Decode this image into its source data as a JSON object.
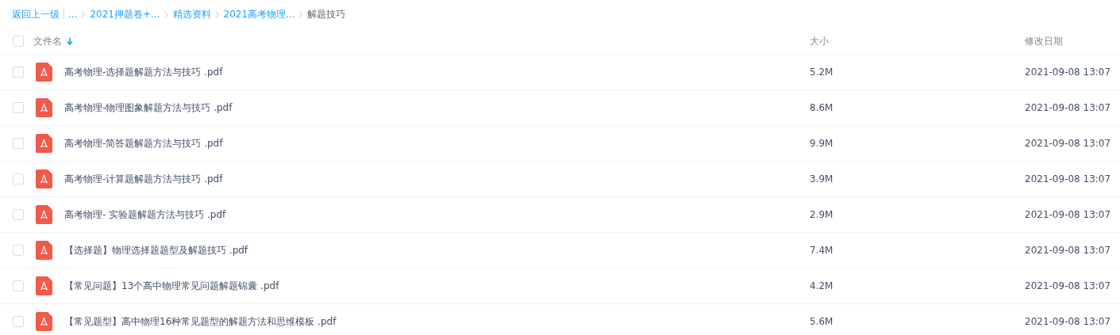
{
  "breadcrumb": {
    "back": "返回上一级",
    "items": [
      {
        "label": "..."
      },
      {
        "label": "2021押题卷+..."
      },
      {
        "label": "精选资料"
      },
      {
        "label": "2021高考物理..."
      },
      {
        "label": "解题技巧"
      }
    ]
  },
  "table": {
    "select_all": {
      "checked": false
    },
    "columns": [
      {
        "label": "文件名",
        "sorted": true
      },
      {
        "label": "大小",
        "sorted": false
      },
      {
        "label": "修改日期",
        "sorted": false
      }
    ],
    "rows": [
      {
        "checked": false,
        "name": "高考物理-选择题解题方法与技巧 .pdf",
        "size": "5.2M",
        "date": "2021-09-08 13:07"
      },
      {
        "checked": false,
        "name": "高考物理-物理图象解题方法与技巧 .pdf",
        "size": "8.6M",
        "date": "2021-09-08 13:07"
      },
      {
        "checked": false,
        "name": "高考物理-简答题解题方法与技巧 .pdf",
        "size": "9.9M",
        "date": "2021-09-08 13:07"
      },
      {
        "checked": false,
        "name": "高考物理-计算题解题方法与技巧 .pdf",
        "size": "3.9M",
        "date": "2021-09-08 13:07"
      },
      {
        "checked": false,
        "name": "高考物理- 实验题解题方法与技巧 .pdf",
        "size": "2.9M",
        "date": "2021-09-08 13:07"
      },
      {
        "checked": false,
        "name": "【选择题】物理选择题题型及解题技巧 .pdf",
        "size": "7.4M",
        "date": "2021-09-08 13:07"
      },
      {
        "checked": false,
        "name": "【常见问题】13个高中物理常见问题解题锦囊 .pdf",
        "size": "4.2M",
        "date": "2021-09-08 13:07"
      },
      {
        "checked": false,
        "name": "【常见题型】高中物理16种常见题型的解题方法和思维模板 .pdf",
        "size": "5.6M",
        "date": "2021-09-08 13:07"
      }
    ]
  }
}
